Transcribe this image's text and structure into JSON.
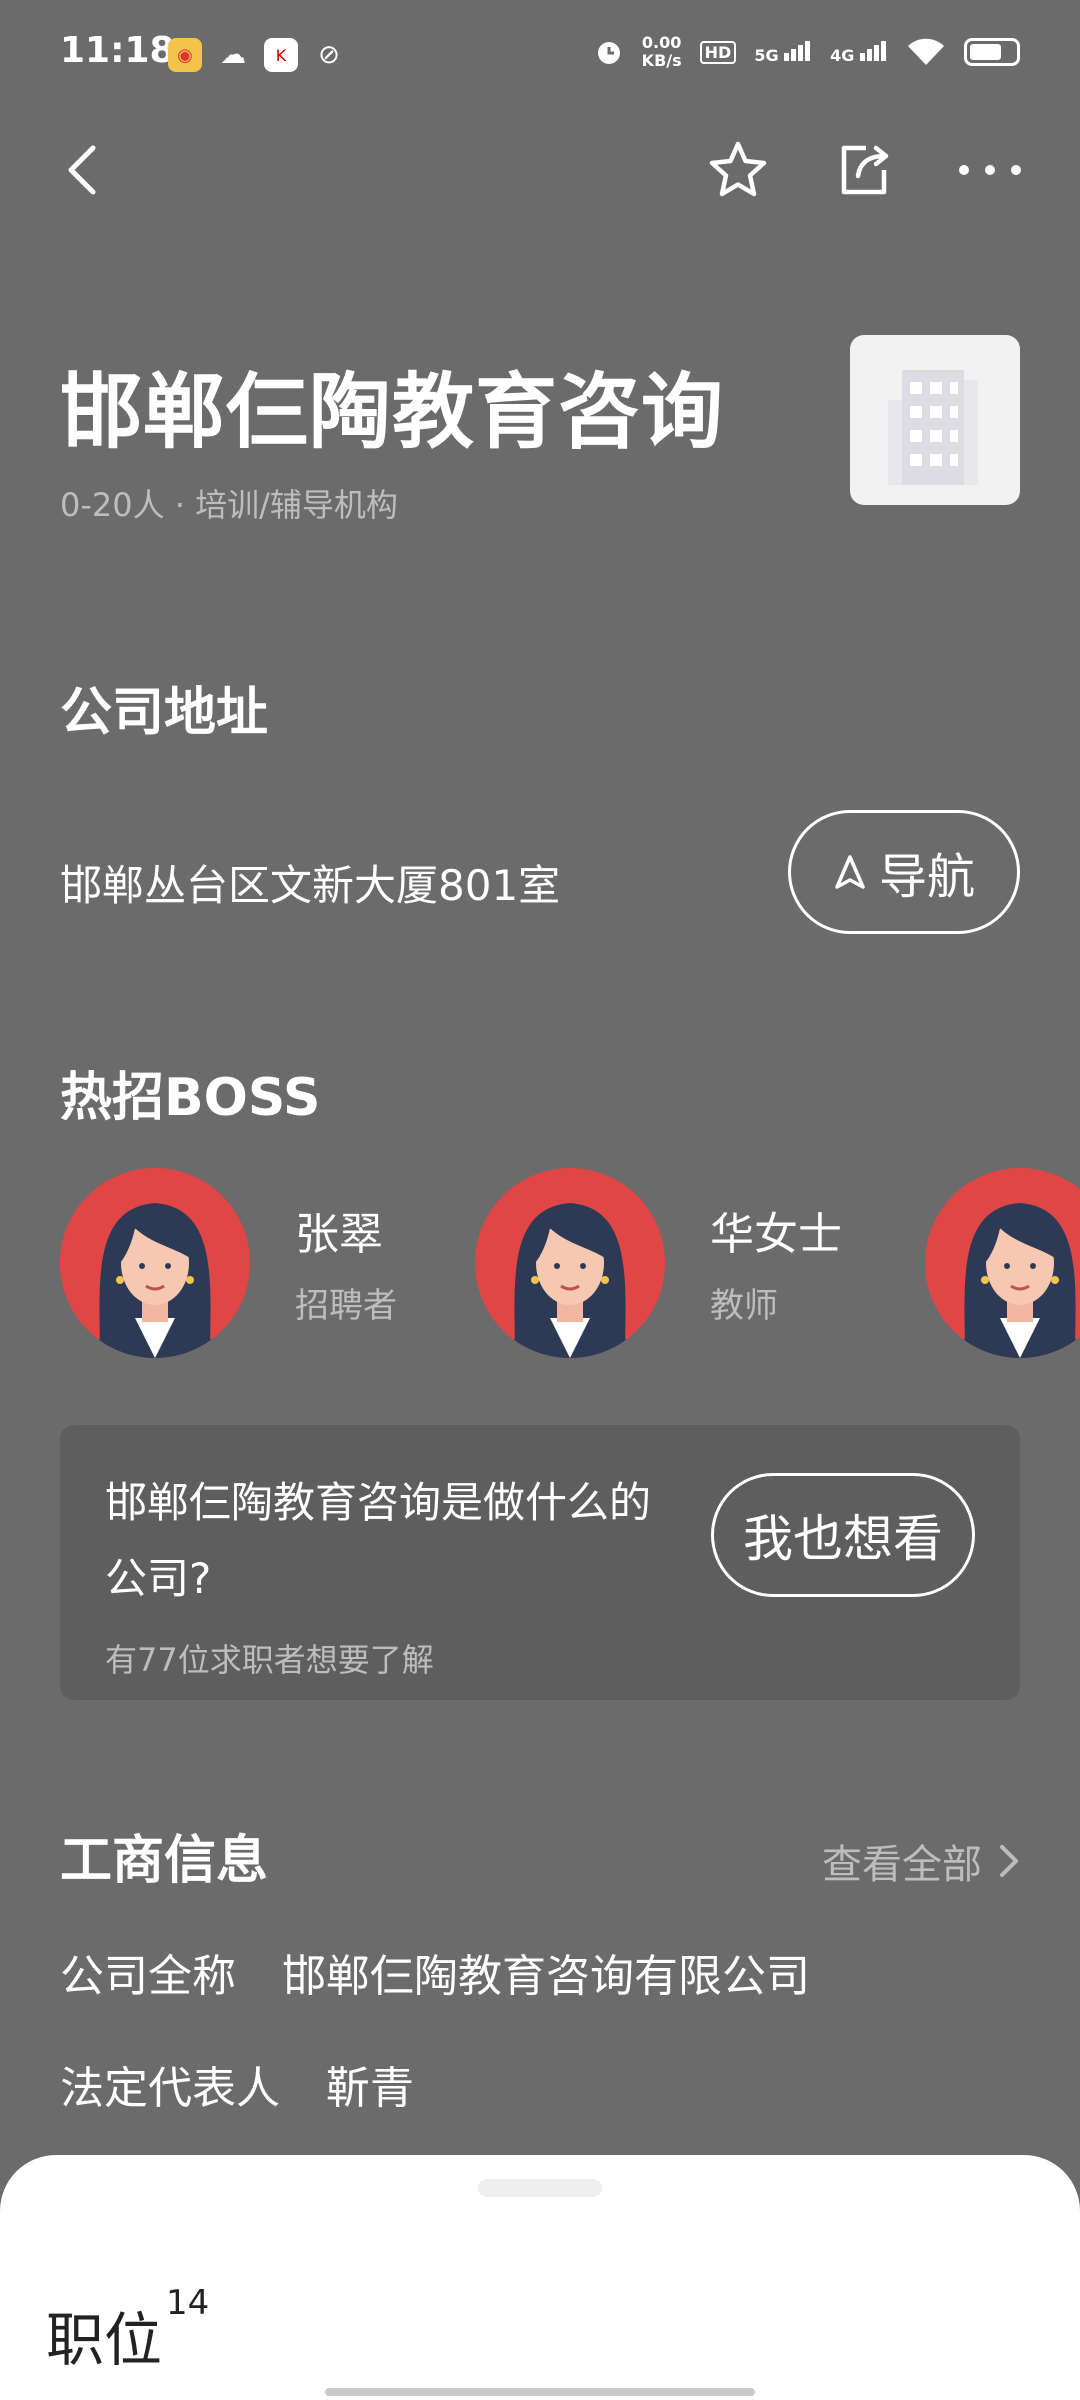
{
  "status_bar": {
    "time": "11:18",
    "net_speed_top": "0.00",
    "net_speed_bottom": "KB/s",
    "hd_label": "HD",
    "sim1": "5G",
    "sim2": "4G",
    "battery_level": 0.7,
    "apps": [
      "weibo-icon",
      "wechat-icon",
      "kfc-icon",
      "link-icon"
    ]
  },
  "nav": {
    "icons": [
      "back-arrow-icon",
      "star-icon",
      "share-icon",
      "more-dots-icon"
    ]
  },
  "company": {
    "name": "邯郸仨陶教育咨询",
    "meta": "0-20人 · 培训/辅导机构",
    "logo_icon": "building-icon"
  },
  "address": {
    "title": "公司地址",
    "text": "邯郸丛台区文新大厦801室",
    "nav_button": "导航"
  },
  "hot_boss": {
    "title": "热招BOSS",
    "items": [
      {
        "name": "张翠",
        "role": "招聘者"
      },
      {
        "name": "华女士",
        "role": "教师"
      },
      {
        "name": "",
        "role": ""
      }
    ]
  },
  "question_card": {
    "question": "邯郸仨陶教育咨询是做什么的公司?",
    "sub": "有77位求职者想要了解",
    "button": "我也想看"
  },
  "business_info": {
    "title": "工商信息",
    "view_all": "查看全部",
    "rows": [
      {
        "label": "公司全称",
        "value": "邯郸仨陶教育咨询有限公司"
      },
      {
        "label": "法定代表人",
        "value": "靳青"
      }
    ]
  },
  "sheet": {
    "jobs_label": "职位",
    "jobs_count": "14"
  },
  "colors": {
    "background": "#6b6b6b",
    "card": "#5e5e5e",
    "avatar_bg": "#e04646",
    "muted_text": "#bdbdbd"
  }
}
